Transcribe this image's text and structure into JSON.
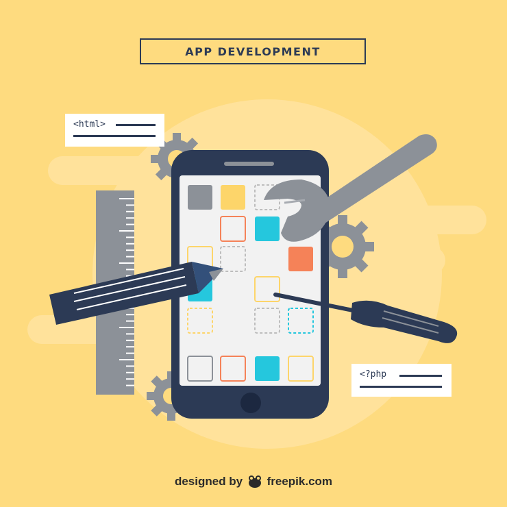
{
  "title": "APP DEVELOPMENT",
  "cards": {
    "html": {
      "tag": "<html>"
    },
    "php": {
      "tag": "<?php"
    }
  },
  "credit": {
    "prefix": "designed by",
    "brand": "freepik.com"
  },
  "colors": {
    "background": "#fedb7f",
    "blob": "#ffe29b",
    "navy": "#2c3a55",
    "gray": "#8c9198",
    "cyan": "#25c7dd",
    "orange": "#f58258",
    "yellow": "#fdd56a"
  },
  "icons": [
    "gear-icon",
    "wrench-icon",
    "pencil-icon",
    "screwdriver-icon",
    "ruler-icon",
    "smartphone-icon",
    "freepik-logo-icon"
  ]
}
